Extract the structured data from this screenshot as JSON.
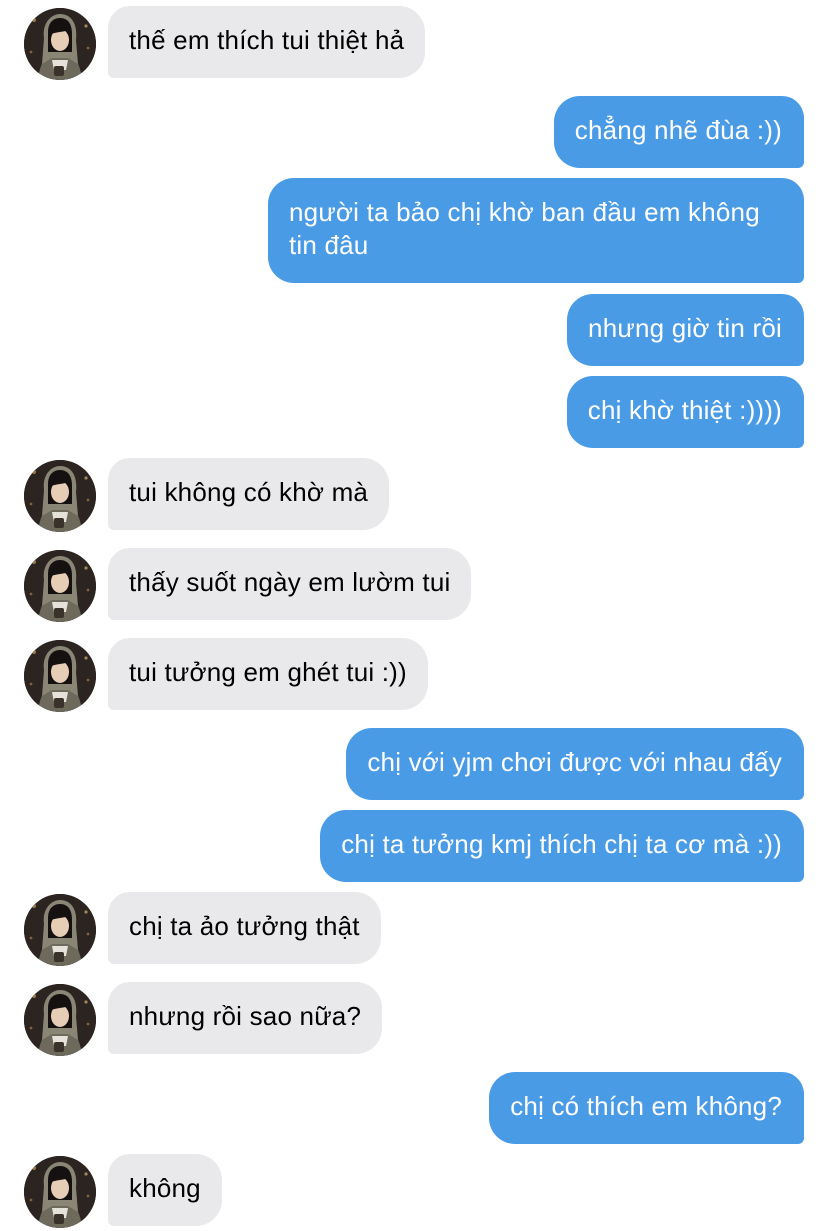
{
  "colors": {
    "incoming_bubble": "#e9e9eb",
    "outgoing_bubble": "#4a9be6",
    "incoming_text": "#000000",
    "outgoing_text": "#ffffff",
    "background": "#ffffff"
  },
  "contact": {
    "avatar_icon": "contact-avatar-photo"
  },
  "messages": [
    {
      "direction": "incoming",
      "text": "thế em thích tui thiệt hả"
    },
    {
      "direction": "outgoing",
      "text": "chẳng nhẽ đùa :))"
    },
    {
      "direction": "outgoing",
      "text": "người ta bảo chị khờ ban đầu em không tin đâu"
    },
    {
      "direction": "outgoing",
      "text": "nhưng giờ tin rồi"
    },
    {
      "direction": "outgoing",
      "text": "chị khờ thiệt :))))"
    },
    {
      "direction": "incoming",
      "text": "tui không có khờ mà"
    },
    {
      "direction": "incoming",
      "text": "thấy suốt ngày em lườm tui"
    },
    {
      "direction": "incoming",
      "text": "tui tưởng em ghét tui :))"
    },
    {
      "direction": "outgoing",
      "text": "chị với yjm chơi được với nhau đấy"
    },
    {
      "direction": "outgoing",
      "text": "chị ta tưởng kmj thích chị ta cơ mà :))"
    },
    {
      "direction": "incoming",
      "text": "chị ta ảo tưởng thật"
    },
    {
      "direction": "incoming",
      "text": "nhưng rồi sao nữa?"
    },
    {
      "direction": "outgoing",
      "text": "chị có thích em không?"
    },
    {
      "direction": "incoming",
      "text": "không"
    }
  ]
}
